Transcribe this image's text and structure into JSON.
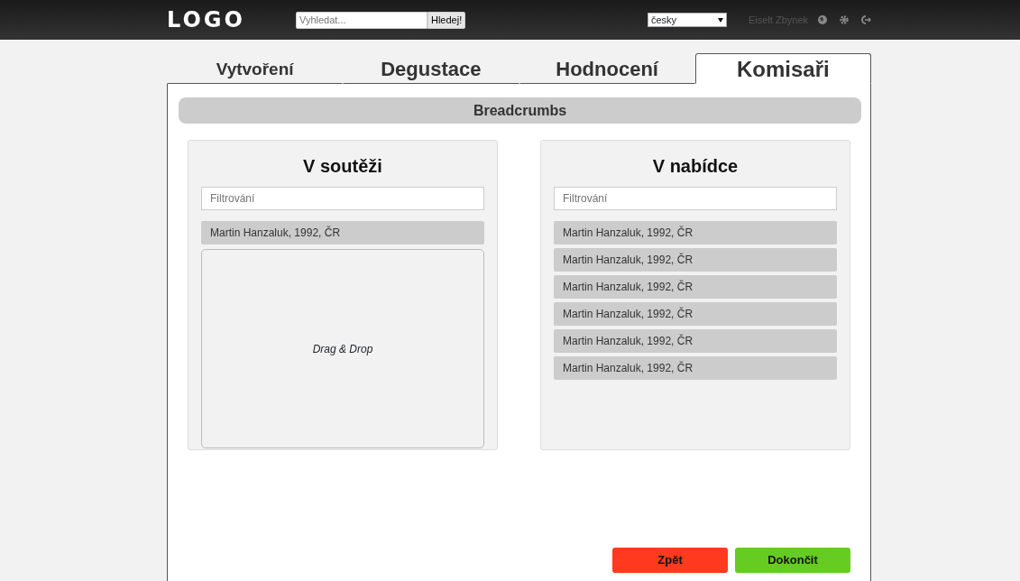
{
  "header": {
    "logo": "LOGO",
    "search": {
      "placeholder": "Vyhledat...",
      "button": "Hledej!"
    },
    "language": "česky",
    "user": "Eiselt Zbynek"
  },
  "tabs": [
    {
      "label": "Vytvoření",
      "selected": false
    },
    {
      "label": "Degustace",
      "selected": false
    },
    {
      "label": "Hodnocení",
      "selected": false
    },
    {
      "label": "Komisaři",
      "selected": true
    }
  ],
  "breadcrumbs": "Breadcrumbs",
  "columns": [
    {
      "title": "V soutěži",
      "filter": {
        "placeholder": "Filtrování"
      },
      "items": [
        "Martin Hanzaluk, 1992, ČR"
      ],
      "drop_zone": "Drag & Drop"
    },
    {
      "title": "V nabídce",
      "filter": {
        "placeholder": "Filtrování"
      },
      "items": [
        "Martin Hanzaluk, 1992, ČR",
        "Martin Hanzaluk, 1992, ČR",
        "Martin Hanzaluk, 1992, ČR",
        "Martin Hanzaluk, 1992, ČR",
        "Martin Hanzaluk, 1992, ČR",
        "Martin Hanzaluk, 1992, ČR"
      ]
    }
  ],
  "buttons": [
    {
      "label": "Zpět",
      "kind": "back"
    },
    {
      "label": "Dokončit",
      "kind": "finish"
    }
  ]
}
